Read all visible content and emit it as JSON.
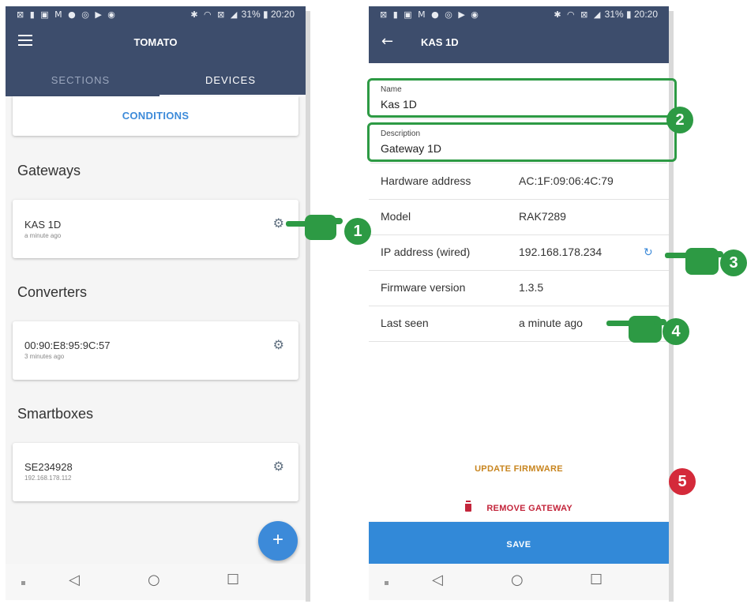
{
  "status_bar": {
    "left_icons": "⊠ ▮ ▣ M ● ◎ ▶ ◉",
    "right_icons": "✱ ◠ ⊠ ◢",
    "battery": "31%",
    "time": "20:20"
  },
  "left_screen": {
    "title": "TOMATO",
    "tabs": [
      {
        "label": "SECTIONS"
      },
      {
        "label": "DEVICES"
      }
    ],
    "conditions_label": "CONDITIONS",
    "sections": [
      {
        "heading": "Gateways",
        "device": {
          "name": "KAS 1D",
          "subtitle": "a minute ago"
        }
      },
      {
        "heading": "Converters",
        "device": {
          "name": "00:90:E8:95:9C:57",
          "subtitle": "3 minutes ago"
        }
      },
      {
        "heading": "Smartboxes",
        "device": {
          "name": "SE234928",
          "subtitle": "192.168.178.112"
        }
      }
    ],
    "fab_label": "+"
  },
  "right_screen": {
    "title": "KAS 1D",
    "name_field": {
      "label": "Name",
      "value": "Kas 1D"
    },
    "description_field": {
      "label": "Description",
      "value": "Gateway 1D"
    },
    "rows": [
      {
        "label": "Hardware address",
        "value": "AC:1F:09:06:4C:79"
      },
      {
        "label": "Model",
        "value": "RAK7289"
      },
      {
        "label": "IP address (wired)",
        "value": "192.168.178.234"
      },
      {
        "label": "Firmware version",
        "value": "1.3.5"
      },
      {
        "label": "Last seen",
        "value": "a minute ago"
      }
    ],
    "update_firmware_label": "UPDATE FIRMWARE",
    "remove_gateway_label": "REMOVE GATEWAY",
    "save_label": "SAVE"
  },
  "annotations": {
    "m1": "1",
    "m2": "2",
    "m3": "3",
    "m4": "4",
    "m5": "5"
  },
  "colors": {
    "header": "#3d4d6c",
    "accent": "#3c8ad9",
    "annotation_green": "#2d9a44",
    "annotation_red": "#d42a3a",
    "update_orange": "#c8851f",
    "remove_red": "#c3253b"
  }
}
